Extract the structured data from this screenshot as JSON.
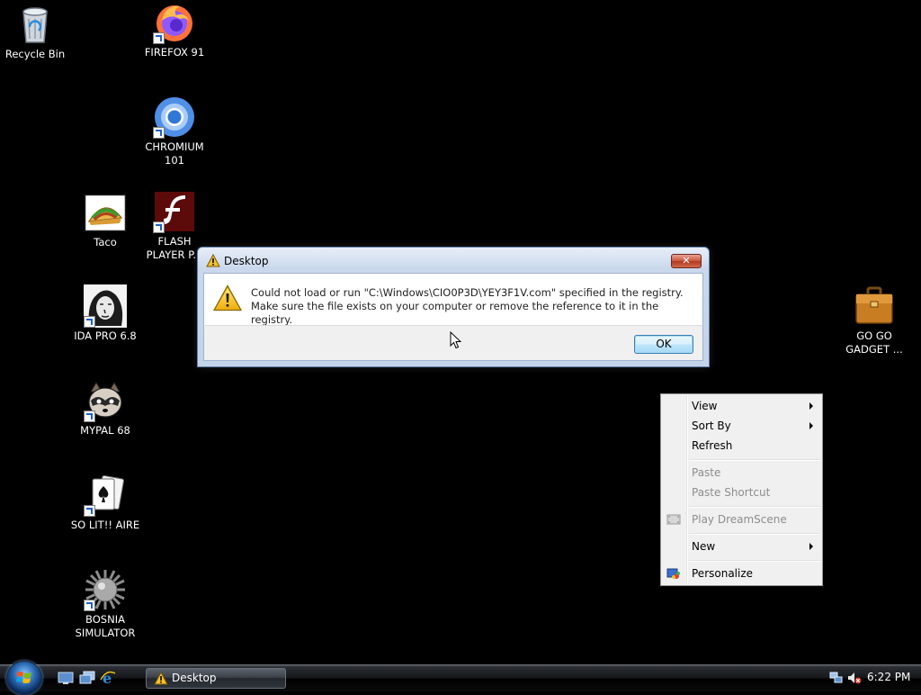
{
  "desktop_icons": [
    {
      "key": "recycle-bin",
      "label": "Recycle Bin",
      "shortcut": false
    },
    {
      "key": "firefox",
      "label": "FIREFOX 91",
      "shortcut": true
    },
    {
      "key": "chromium",
      "label": "CHROMIUM 101",
      "shortcut": true
    },
    {
      "key": "taco",
      "label": "Taco",
      "shortcut": false
    },
    {
      "key": "flash-player",
      "label": "FLASH PLAYER P...",
      "shortcut": true
    },
    {
      "key": "ida-pro",
      "label": "IDA PRO 6.8",
      "shortcut": true
    },
    {
      "key": "mypal",
      "label": "MYPAL 68",
      "shortcut": true
    },
    {
      "key": "solitaire",
      "label": "SO LIT!! AIRE",
      "shortcut": true
    },
    {
      "key": "bosnia-simulator",
      "label": "BOSNIA SIMULATOR",
      "shortcut": true
    },
    {
      "key": "go-go-gadget",
      "label": "GO GO GADGET ...",
      "shortcut": false
    }
  ],
  "dialog": {
    "title": "Desktop",
    "message": "Could not load or run \"C:\\Windows\\CIO0P3D\\YEY3F1V.com\" specified in the registry. Make sure the file exists on your computer or remove the reference to it in the registry.",
    "ok_label": "OK",
    "close_glyph": "✕"
  },
  "context_menu": {
    "items": [
      {
        "label": "View",
        "submenu": true,
        "disabled": false
      },
      {
        "label": "Sort By",
        "submenu": true,
        "disabled": false
      },
      {
        "label": "Refresh",
        "submenu": false,
        "disabled": false
      },
      {
        "label": "Paste",
        "submenu": false,
        "disabled": true
      },
      {
        "label": "Paste Shortcut",
        "submenu": false,
        "disabled": true
      },
      {
        "label": "Play DreamScene",
        "submenu": false,
        "disabled": true,
        "icon": "dreamscene-icon"
      },
      {
        "label": "New",
        "submenu": true,
        "disabled": false
      },
      {
        "label": "Personalize",
        "submenu": false,
        "disabled": false,
        "icon": "personalize-icon"
      }
    ]
  },
  "taskbar": {
    "quick_launch": [
      "show-desktop-icon",
      "switch-windows-icon",
      "internet-explorer-icon"
    ],
    "task_label": "Desktop",
    "clock": "6:22 PM",
    "tray_icons": [
      "network-icon",
      "volume-muted-icon"
    ]
  },
  "colors": {
    "background": "#000000",
    "dialog_frame": "#c3d3ea",
    "ok_button": "#bee6fd",
    "close_button": "#c9553c"
  }
}
